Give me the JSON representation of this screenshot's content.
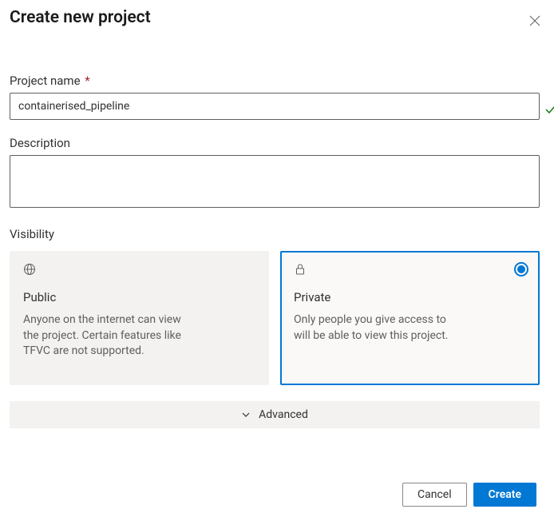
{
  "header": {
    "title": "Create new project"
  },
  "fields": {
    "project_name_label": "Project name",
    "project_name_value": "containerised_pipeline",
    "description_label": "Description",
    "description_value": "",
    "visibility_label": "Visibility"
  },
  "visibility": {
    "public": {
      "title": "Public",
      "desc": "Anyone on the internet can view the project. Certain features like TFVC are not supported."
    },
    "private": {
      "title": "Private",
      "desc": "Only people you give access to will be able to view this project."
    },
    "selected": "private"
  },
  "advanced_label": "Advanced",
  "buttons": {
    "cancel": "Cancel",
    "create": "Create"
  }
}
